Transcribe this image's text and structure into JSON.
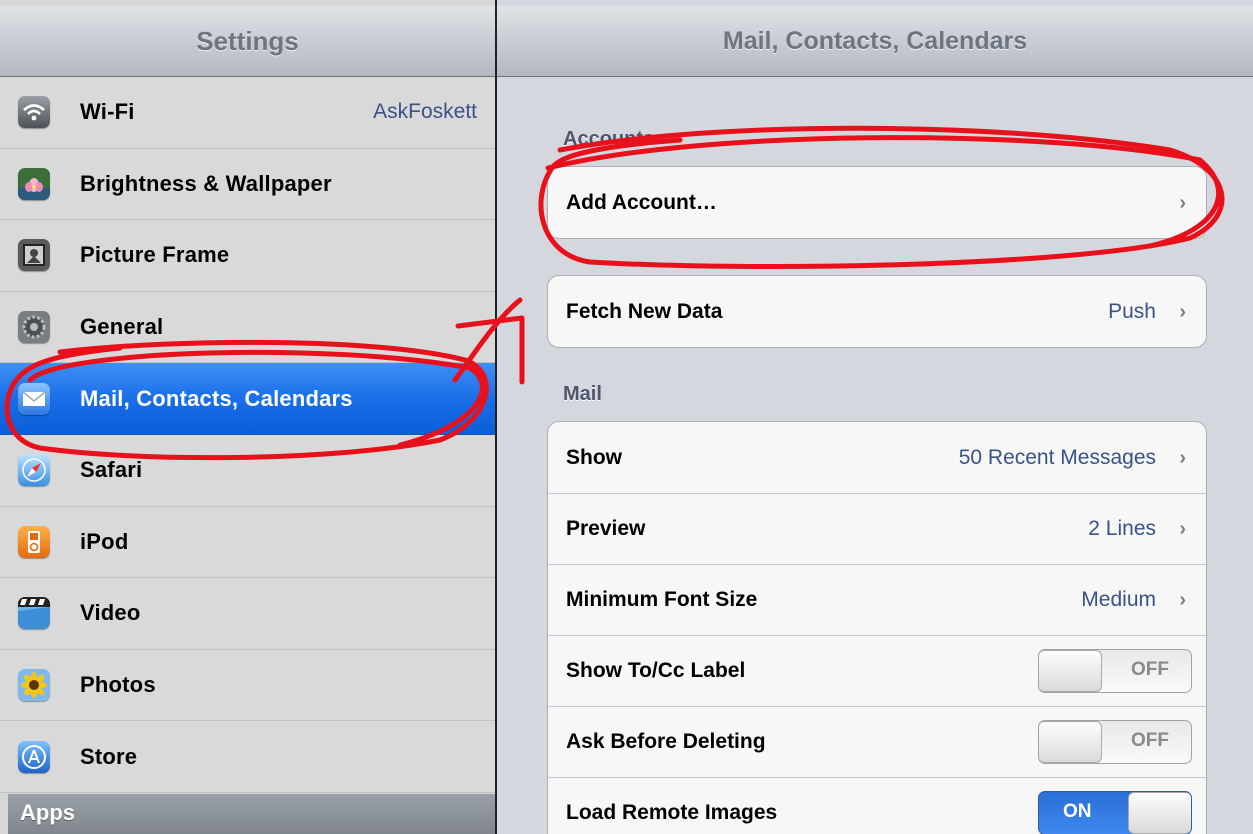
{
  "left": {
    "title": "Settings",
    "items": [
      {
        "label": "Wi-Fi",
        "value": "AskFoskett",
        "icon": "wifi-icon"
      },
      {
        "label": "Brightness & Wallpaper",
        "icon": "brightness-wallpaper-icon"
      },
      {
        "label": "Picture Frame",
        "icon": "picture-frame-icon"
      },
      {
        "label": "General",
        "icon": "gear-icon"
      },
      {
        "label": "Mail, Contacts, Calendars",
        "icon": "mail-icon",
        "selected": true
      },
      {
        "label": "Safari",
        "icon": "safari-icon"
      },
      {
        "label": "iPod",
        "icon": "ipod-icon"
      },
      {
        "label": "Video",
        "icon": "video-icon"
      },
      {
        "label": "Photos",
        "icon": "photos-icon"
      },
      {
        "label": "Store",
        "icon": "store-icon"
      }
    ],
    "section": "Apps"
  },
  "right": {
    "title": "Mail, Contacts, Calendars",
    "accounts_header": "Accounts",
    "add_account": "Add Account…",
    "fetch": {
      "label": "Fetch New Data",
      "value": "Push"
    },
    "mail_header": "Mail",
    "mail": [
      {
        "label": "Show",
        "value": "50 Recent Messages"
      },
      {
        "label": "Preview",
        "value": "2 Lines"
      },
      {
        "label": "Minimum Font Size",
        "value": "Medium"
      },
      {
        "label": "Show To/Cc Label",
        "toggle": "OFF"
      },
      {
        "label": "Ask Before Deleting",
        "toggle": "OFF"
      },
      {
        "label": "Load Remote Images",
        "toggle": "ON"
      }
    ],
    "chevron": "›"
  },
  "colors": {
    "accent_blue": "#1a6fe8",
    "value_blue": "#385487",
    "annotation_red": "#e8101a"
  }
}
